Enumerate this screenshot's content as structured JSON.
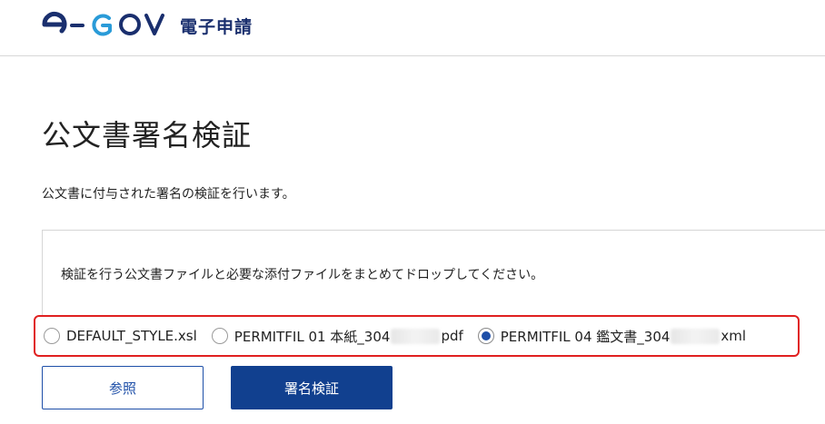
{
  "header": {
    "logo_text": "電子申請",
    "logo_brand": "e-GOV"
  },
  "main": {
    "title": "公文書署名検証",
    "description": "公文書に付与された署名の検証を行います。",
    "drop_text": "検証を行う公文書ファイルと必要な添付ファイルをまとめてドロップしてください。"
  },
  "files": [
    {
      "prefix": "DEFAULT_STYLE.xsl",
      "suffix": "",
      "selected": false,
      "redacted": false
    },
    {
      "prefix": "PERMITFIL 01 本紙_304",
      "suffix": "pdf",
      "selected": false,
      "redacted": true
    },
    {
      "prefix": "PERMITFIL 04 鑑文書_304",
      "suffix": "xml",
      "selected": true,
      "redacted": true
    }
  ],
  "buttons": {
    "browse": "参照",
    "verify": "署名検証"
  },
  "colors": {
    "brand_navy": "#1a2f6e",
    "primary": "#11408f",
    "highlight_border": "#e02020"
  }
}
